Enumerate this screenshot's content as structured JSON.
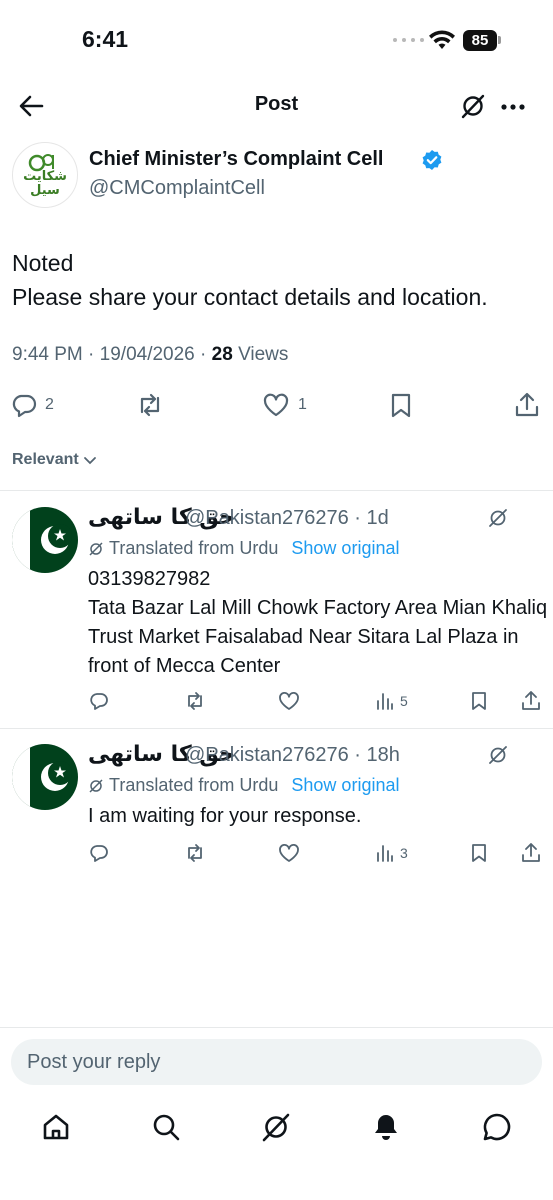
{
  "status_bar": {
    "time": "6:41",
    "battery": "85"
  },
  "header": {
    "title": "Post"
  },
  "post": {
    "author_name": "Chief Minister’s Complaint Cell",
    "author_handle": "@CMComplaintCell",
    "avatar_text_top": "شکایت",
    "avatar_text_bottom": "سیل",
    "text": "Noted\nPlease share your contact details and location.",
    "time": "9:44 PM",
    "date": "19/04/2026",
    "views_count": "28",
    "views_label": "Views",
    "replies_count": "2",
    "likes_count": "1"
  },
  "sort": {
    "label": "Relevant"
  },
  "replies": [
    {
      "name": "حق کا ساتھی",
      "handle": "@Pakistan276276",
      "time": "1d",
      "translated_label": "Translated from Urdu",
      "show_original": "Show original",
      "text": "03139827982\nTata Bazar Lal Mill Chowk Factory Area Mian Khaliq Trust Market Faisalabad Near Sitara Lal Plaza in front of Mecca Center",
      "views": "5"
    },
    {
      "name": "حق کا ساتھی",
      "handle": "@Pakistan276276",
      "time": "18h",
      "translated_label": "Translated from Urdu",
      "show_original": "Show original",
      "text": "I am waiting for your response.",
      "views": "3"
    }
  ],
  "composer": {
    "placeholder": "Post your reply"
  },
  "colors": {
    "accent": "#1d9bf0",
    "muted": "#536471",
    "text": "#0f1419",
    "flag_green": "#01411c"
  }
}
